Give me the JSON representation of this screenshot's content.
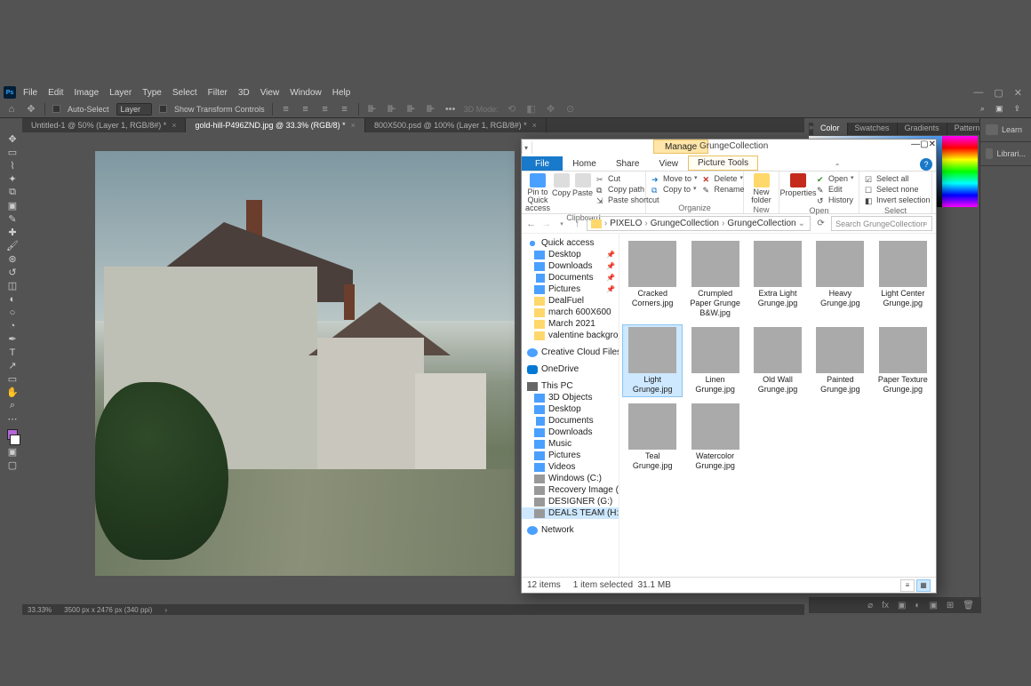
{
  "photoshop": {
    "menus": [
      "File",
      "Edit",
      "Image",
      "Layer",
      "Type",
      "Select",
      "Filter",
      "3D",
      "View",
      "Window",
      "Help"
    ],
    "options": {
      "auto_select_label": "Auto-Select",
      "auto_select_mode": "Layer",
      "show_transform_label": "Show Transform Controls",
      "mode_3d": "3D Mode:"
    },
    "tabs": [
      {
        "title": "Untitled-1 @ 50% (Layer 1, RGB/8#) *"
      },
      {
        "title": "gold-hill-P496ZND.jpg @ 33.3% (RGB/8) *"
      },
      {
        "title": "800X500.psd @ 100% (Layer 1, RGB/8#) *"
      }
    ],
    "active_tab": 1,
    "status": {
      "zoom": "33.33%",
      "doc": "3500 px x 2476 px (340 ppi)"
    },
    "panel_tabs": [
      "Color",
      "Swatches",
      "Gradients",
      "Patterns"
    ],
    "right_panels": [
      {
        "label": "Learn"
      },
      {
        "label": "Librari..."
      }
    ]
  },
  "explorer": {
    "manage_label": "Manage",
    "window_title": "GrungeCollection",
    "tabs": {
      "file": "File",
      "home": "Home",
      "share": "Share",
      "view": "View",
      "picture": "Picture Tools"
    },
    "ribbon": {
      "clipboard": {
        "label": "Clipboard",
        "pin": "Pin to Quick access",
        "copy": "Copy",
        "paste": "Paste",
        "cut": "Cut",
        "copy_path": "Copy path",
        "paste_shortcut": "Paste shortcut"
      },
      "organize": {
        "label": "Organize",
        "move_to": "Move to",
        "copy_to": "Copy to",
        "delete": "Delete",
        "rename": "Rename"
      },
      "new": {
        "label": "New",
        "new_folder": "New folder"
      },
      "open": {
        "label": "Open",
        "properties": "Properties",
        "open": "Open",
        "edit": "Edit",
        "history": "History"
      },
      "select": {
        "label": "Select",
        "select_all": "Select all",
        "select_none": "Select none",
        "invert": "Invert selection"
      }
    },
    "breadcrumbs": [
      "PIXELO",
      "GrungeCollection",
      "GrungeCollection"
    ],
    "search_placeholder": "Search GrungeCollection",
    "nav": {
      "quick_access": "Quick access",
      "quick_items": [
        {
          "label": "Desktop",
          "icon": "desktop",
          "pinned": true
        },
        {
          "label": "Downloads",
          "icon": "dl",
          "pinned": true
        },
        {
          "label": "Documents",
          "icon": "doc",
          "pinned": true
        },
        {
          "label": "Pictures",
          "icon": "pic",
          "pinned": true
        },
        {
          "label": "DealFuel",
          "icon": "folder"
        },
        {
          "label": "march 600X600",
          "icon": "folder"
        },
        {
          "label": "March 2021",
          "icon": "folder"
        },
        {
          "label": "valentine backgrou",
          "icon": "folder"
        }
      ],
      "creative_cloud": "Creative Cloud Files",
      "onedrive": "OneDrive",
      "this_pc": "This PC",
      "pc_items": [
        {
          "label": "3D Objects",
          "icon": "obj"
        },
        {
          "label": "Desktop",
          "icon": "desktop"
        },
        {
          "label": "Documents",
          "icon": "doc"
        },
        {
          "label": "Downloads",
          "icon": "dl"
        },
        {
          "label": "Music",
          "icon": "music"
        },
        {
          "label": "Pictures",
          "icon": "pic"
        },
        {
          "label": "Videos",
          "icon": "vid"
        },
        {
          "label": "Windows (C:)",
          "icon": "drive"
        },
        {
          "label": "Recovery Image (D:",
          "icon": "drive"
        },
        {
          "label": "DESIGNER (G:)",
          "icon": "drive"
        },
        {
          "label": "DEALS TEAM (H:)",
          "icon": "drive",
          "selected": true
        }
      ],
      "network": "Network"
    },
    "files": [
      {
        "name": "Cracked Corners.jpg",
        "thumb": "th-cracked"
      },
      {
        "name": "Crumpled Paper Grunge B&W.jpg",
        "thumb": "th-crumpled"
      },
      {
        "name": "Extra Light Grunge.jpg",
        "thumb": "th-extralight"
      },
      {
        "name": "Heavy Grunge.jpg",
        "thumb": "th-heavy"
      },
      {
        "name": "Light Center Grunge.jpg",
        "thumb": "th-lightcenter"
      },
      {
        "name": "Light Grunge.jpg",
        "thumb": "th-light",
        "selected": true
      },
      {
        "name": "Linen Grunge.jpg",
        "thumb": "th-linen"
      },
      {
        "name": "Old Wall Grunge.jpg",
        "thumb": "th-oldwall"
      },
      {
        "name": "Painted Grunge.jpg",
        "thumb": "th-painted"
      },
      {
        "name": "Paper Texture Grunge.jpg",
        "thumb": "th-papertex"
      },
      {
        "name": "Teal Grunge.jpg",
        "thumb": "th-teal"
      },
      {
        "name": "Watercolor Grunge.jpg",
        "thumb": "th-watercolor"
      }
    ],
    "status": {
      "count": "12 items",
      "selection": "1 item selected",
      "size": "31.1 MB"
    }
  }
}
